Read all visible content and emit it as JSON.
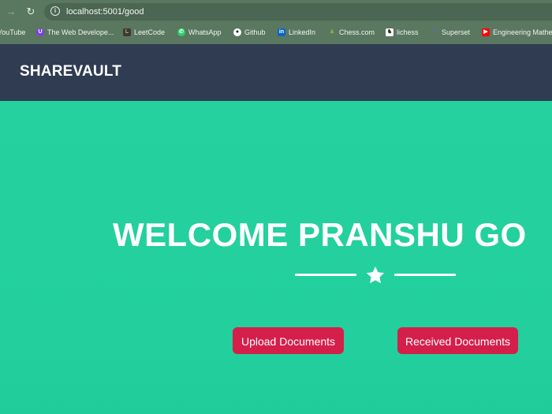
{
  "browser": {
    "url": "localhost:5001/good",
    "bookmarks": [
      {
        "label": "YouTube",
        "icon": "youtube-icon"
      },
      {
        "label": "The Web Develope...",
        "icon": "udemy-icon"
      },
      {
        "label": "LeetCode",
        "icon": "leetcode-icon"
      },
      {
        "label": "WhatsApp",
        "icon": "whatsapp-icon"
      },
      {
        "label": "Github",
        "icon": "github-icon"
      },
      {
        "label": "LinkedIn",
        "icon": "linkedin-icon"
      },
      {
        "label": "Chess.com",
        "icon": "chess-icon"
      },
      {
        "label": "lichess",
        "icon": "lichess-icon"
      },
      {
        "label": "Superset",
        "icon": "superset-icon"
      },
      {
        "label": "Engineering Mathe",
        "icon": "youtube-icon"
      }
    ]
  },
  "navbar": {
    "brand": "SHAREVAULT"
  },
  "hero": {
    "welcome": "WELCOME PRANSHU GO",
    "upload_label": "Upload Documents",
    "received_label": "Received Documents"
  },
  "colors": {
    "navbar": "#2f3c52",
    "hero": "#22cf9d",
    "button": "#d41f4a"
  }
}
